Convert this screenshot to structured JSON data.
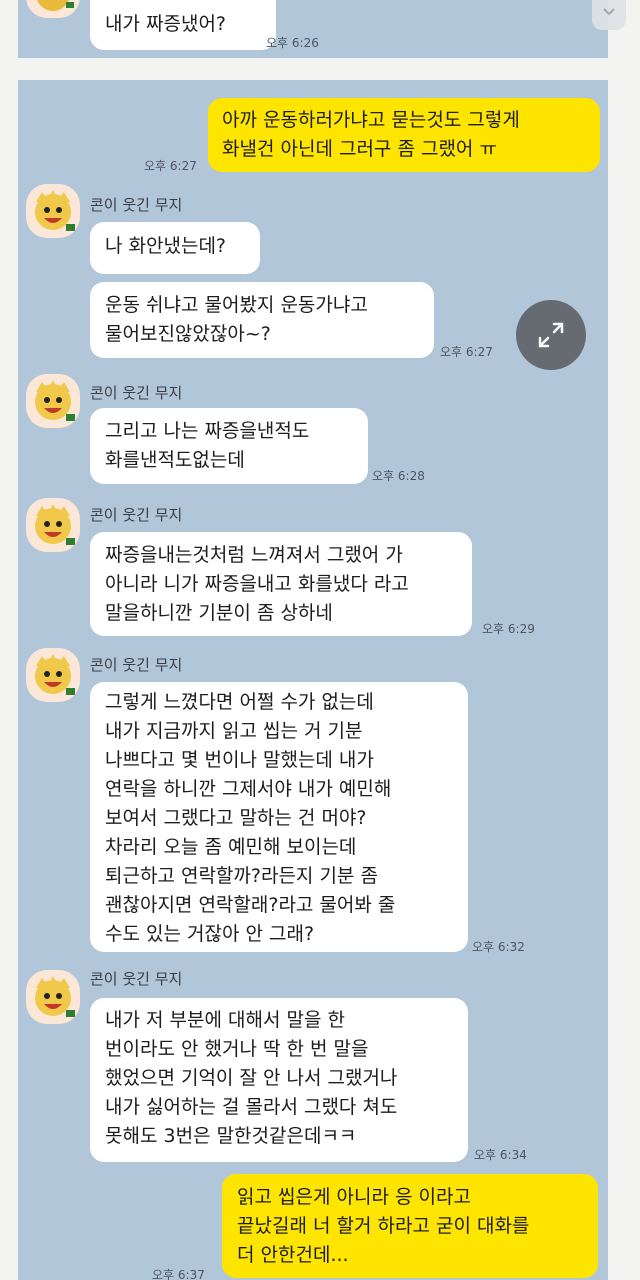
{
  "colors": {
    "chat_background": "#b2c6d9",
    "incoming_bubble": "#ffffff",
    "outgoing_bubble": "#fee500"
  },
  "prev_message": {
    "text": "내가 짜증냈어?",
    "time": "오후 6:26"
  },
  "messages": [
    {
      "direction": "outgoing",
      "text": "아까 운동하러가냐고 묻는것도 그렇게\n화낼건 아닌데 그러구 좀 그랬어 ㅠ",
      "time": "오후 6:27"
    },
    {
      "direction": "incoming",
      "sender": "콘이 웃긴 무지",
      "text": "나 화안냈는데?"
    },
    {
      "direction": "incoming",
      "text": "운동 쉬냐고 물어봤지 운동가냐고\n물어보진않았잖아~?",
      "time": "오후 6:27"
    },
    {
      "direction": "incoming",
      "sender": "콘이 웃긴 무지",
      "text": "그리고 나는 짜증을낸적도\n화를낸적도없는데",
      "time": "오후 6:28"
    },
    {
      "direction": "incoming",
      "sender": "콘이 웃긴 무지",
      "text": "짜증을내는것처럼 느껴져서 그랬어 가\n아니라 니가 짜증을내고 화를냈다 라고\n말을하니깐 기분이 좀 상하네",
      "time": "오후 6:29"
    },
    {
      "direction": "incoming",
      "sender": "콘이 웃긴 무지",
      "text": "그렇게 느꼈다면 어쩔 수가 없는데\n내가 지금까지 읽고 씹는 거 기분\n나쁘다고 몇 번이나 말했는데 내가\n연락을 하니깐 그제서야 내가 예민해\n보여서 그랬다고 말하는 건 머야?\n차라리 오늘 좀 예민해 보이는데\n퇴근하고 연락할까?라든지 기분 좀\n괜찮아지면 연락할래?라고 물어봐 줄\n수도 있는 거잖아 안 그래?",
      "time": "오후 6:32"
    },
    {
      "direction": "incoming",
      "sender": "콘이 웃긴 무지",
      "text": "내가 저 부분에 대해서 말을 한\n번이라도 안 했거나 딱 한 번 말을\n했었으면 기억이 잘 안 나서 그랬거나\n내가 싫어하는 걸 몰라서 그랬다 쳐도\n못해도 3번은 말한것같은데ㅋㅋ",
      "time": "오후 6:34"
    },
    {
      "direction": "outgoing",
      "text": "읽고 씹은게 아니라 응 이라고\n끝났길래 너 할거 하라고 굳이 대화를\n더 안한건데...",
      "time": "오후 6:37"
    }
  ]
}
